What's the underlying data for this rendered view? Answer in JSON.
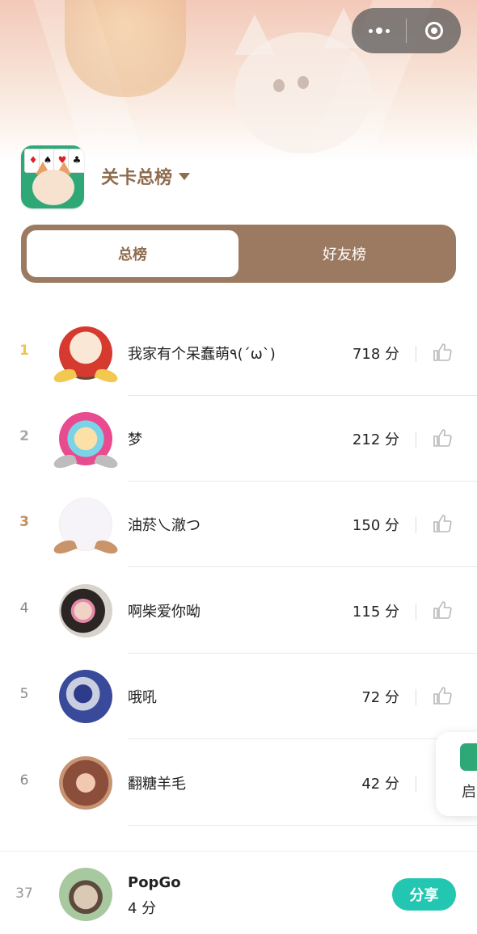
{
  "header": {
    "board_title": "关卡总榜"
  },
  "tabs": [
    {
      "label": "总榜",
      "active": true
    },
    {
      "label": "好友榜",
      "active": false
    }
  ],
  "leaderboard": [
    {
      "rank": "1",
      "name": "我家有个呆蠢萌٩(ˊωˋ)",
      "score": "718 分",
      "avatar": "santa-avatar"
    },
    {
      "rank": "2",
      "name": "梦",
      "score": "212 分",
      "avatar": "anime-girl-avatar"
    },
    {
      "rank": "3",
      "name": "油菸乀澈つ",
      "score": "150 分",
      "avatar": "blank-avatar"
    },
    {
      "rank": "4",
      "name": "啊柴爱你呦",
      "score": "115 分",
      "avatar": "photo-avatar"
    },
    {
      "rank": "5",
      "name": "哦吼",
      "score": "72 分",
      "avatar": "robot-avatar"
    },
    {
      "rank": "6",
      "name": "翻糖羊毛",
      "score": "42 分",
      "avatar": "couple-avatar"
    }
  ],
  "float_card": {
    "text": "启"
  },
  "me": {
    "rank": "37",
    "name": "PopGo",
    "score": "4 分",
    "share_label": "分享"
  },
  "colors": {
    "brand_brown": "#9b7a61",
    "title_brown": "#8f6c4e",
    "share_teal": "#23c6b0",
    "gold": "#f0c34a",
    "silver": "#a9a9a9",
    "bronze": "#c58f5b"
  }
}
